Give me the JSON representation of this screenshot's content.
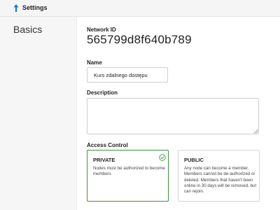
{
  "header": {
    "title": "Settings",
    "back_icon": "arrow-up-icon"
  },
  "section": {
    "title": "Basics"
  },
  "network": {
    "id_label": "Network ID",
    "id_value": "565799d8f640b789"
  },
  "name_field": {
    "label": "Name",
    "value": "Kurs zdalnego dostępu"
  },
  "description_field": {
    "label": "Description",
    "value": ""
  },
  "access_control": {
    "label": "Access Control",
    "options": [
      {
        "title": "PRIVATE",
        "description": "Nodes must be authorized to become members",
        "selected": true
      },
      {
        "title": "PUBLIC",
        "description": "Any node can become a member. Members cannot be de-authorized or deleted. Members that haven't been online in 30 days will be removed, but can rejoin.",
        "selected": false
      }
    ]
  },
  "colors": {
    "accent": "#1a73c7",
    "selected_border": "#3f8f3f",
    "check_green": "#3fa54a",
    "header_bg": "#f5f5f5",
    "sidebar_bg": "#f6f6f6"
  }
}
